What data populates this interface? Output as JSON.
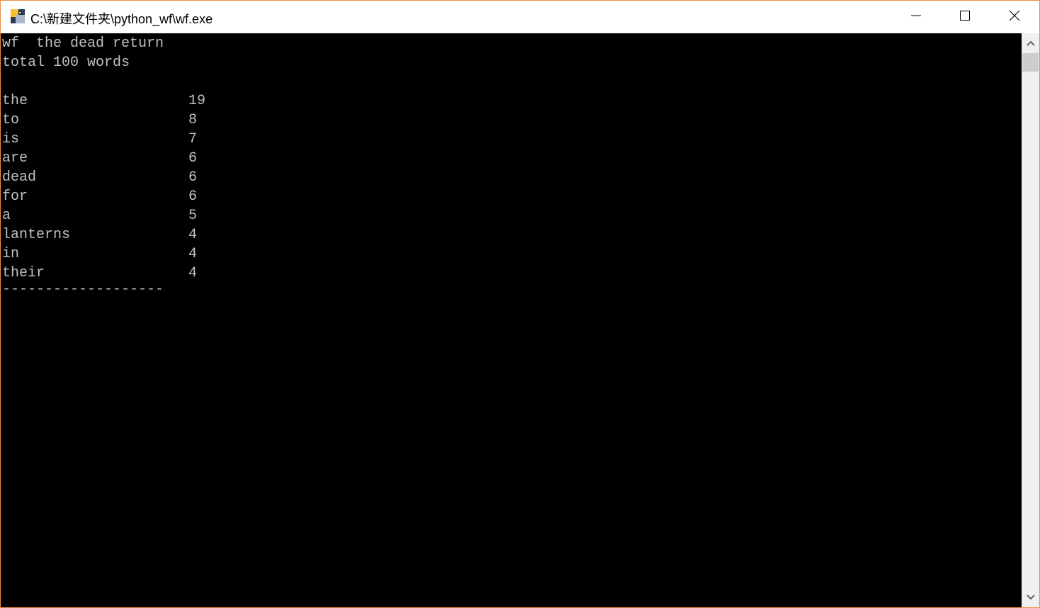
{
  "window": {
    "title": "C:\\新建文件夹\\python_wf\\wf.exe",
    "app_icon": "python-app-icon",
    "controls": {
      "minimize": "minimize-icon",
      "maximize": "maximize-icon",
      "close": "close-icon"
    }
  },
  "console": {
    "command_line": "wf  the dead return",
    "total_line": "total 100 words",
    "rows": [
      {
        "word": "the",
        "count": "19"
      },
      {
        "word": "to",
        "count": "8"
      },
      {
        "word": "is",
        "count": "7"
      },
      {
        "word": "are",
        "count": "6"
      },
      {
        "word": "dead",
        "count": "6"
      },
      {
        "word": "for",
        "count": "6"
      },
      {
        "word": "a",
        "count": "5"
      },
      {
        "word": "lanterns",
        "count": "4"
      },
      {
        "word": "in",
        "count": "4"
      },
      {
        "word": "their",
        "count": "4"
      }
    ],
    "separator": "-------------------"
  },
  "scrollbar": {
    "up_icon": "chevron-up-icon",
    "down_icon": "chevron-down-icon"
  }
}
